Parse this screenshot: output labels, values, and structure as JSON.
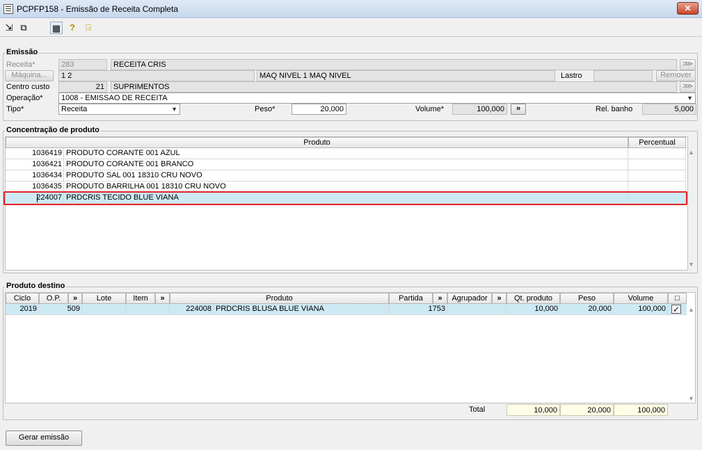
{
  "window": {
    "title": "PCPFP158 - Emissão de Receita Completa",
    "close": "✕"
  },
  "toolbar": {
    "icons": [
      {
        "name": "export-icon",
        "glyph": "⇲"
      },
      {
        "name": "windows-icon",
        "glyph": "⧉"
      },
      {
        "name": "calendar-icon",
        "glyph": "▦"
      },
      {
        "name": "help-icon",
        "glyph": "?"
      },
      {
        "name": "exit-door-icon",
        "glyph": "⍈"
      }
    ]
  },
  "emissao": {
    "group_label": "Emissão",
    "receita_label": "Receita*",
    "receita_code": "283",
    "receita_name": "RECEITA CRIS",
    "maquina_button": "Máquina...",
    "maquina_code": "1 2",
    "maquina_name": "MAQ NIVEL 1 MAQ NIVEL",
    "lastro_label": "Lastro",
    "lastro_value": "",
    "remover_button": "Remover",
    "centro_label": "Centro custo",
    "centro_code": "21",
    "centro_name": "SUPRIMENTOS",
    "operacao_label": "Operação*",
    "operacao_value": "1008 - EMISSAO DE RECEITA",
    "tipo_label": "Tipo*",
    "tipo_value": "Receita",
    "peso_label": "Peso*",
    "peso_value": "20,000",
    "volume_label": "Volume*",
    "volume_value": "100,000",
    "volume_button": "»",
    "rel_banho_label": "Rel. banho",
    "rel_banho_value": "5,000",
    "lookup_glyph": "⋙"
  },
  "concentracao": {
    "group_label": "Concentração de produto",
    "columns": {
      "produto": "Produto",
      "percentual": "Percentual"
    },
    "rows": [
      {
        "code": "1036419",
        "name": "PRODUTO CORANTE 001 AZUL",
        "percentual": ""
      },
      {
        "code": "1036421",
        "name": "PRODUTO CORANTE 001 BRANCO",
        "percentual": ""
      },
      {
        "code": "1036434",
        "name": "PRODUTO SAL 001 18310 CRU NOVO",
        "percentual": ""
      },
      {
        "code": "1036435",
        "name": "PRODUTO BARRILHA 001 18310 CRU NOVO",
        "percentual": ""
      },
      {
        "code": "224007",
        "name": "PRDCRIS TECIDO BLUE VIANA",
        "percentual": ""
      }
    ]
  },
  "destino": {
    "group_label": "Produto destino",
    "columns": {
      "ciclo": "Ciclo",
      "op": "O.P.",
      "op_btn": "»",
      "lote": "Lote",
      "item": "Item",
      "item_btn": "»",
      "produto": "Produto",
      "partida": "Partida",
      "partida_btn": "»",
      "agrupador": "Agrupador",
      "agrupador_btn": "»",
      "qt_produto": "Qt. produto",
      "peso": "Peso",
      "volume": "Volume",
      "check": "□"
    },
    "rows": [
      {
        "ciclo": "2019",
        "op": "509",
        "lote": "",
        "item": "",
        "produto_code": "224008",
        "produto_name": "PRDCRIS BLUSA BLUE VIANA",
        "partida": "1753",
        "agrupador": "",
        "qt_produto": "10,000",
        "peso": "20,000",
        "volume": "100,000",
        "checked": "✓"
      }
    ],
    "total_label": "Total",
    "total_qt": "10,000",
    "total_peso": "20,000",
    "total_volume": "100,000"
  },
  "footer": {
    "gerar_button": "Gerar emissão"
  },
  "colors": {
    "selection": "#cde9f4",
    "highlight_border": "#e0242c",
    "total_bg": "#fffde6"
  }
}
